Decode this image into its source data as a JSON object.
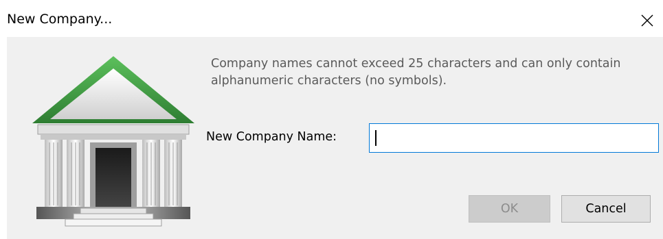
{
  "window": {
    "title": "New Company..."
  },
  "icons": {
    "close": "close-icon",
    "company": "bank-building-icon"
  },
  "dialog": {
    "message": "Company names cannot exceed 25 characters and can only contain alphanumeric characters (no symbols).",
    "name_label": "New Company Name:",
    "name_value": "",
    "ok_label": "OK",
    "cancel_label": "Cancel",
    "ok_enabled": false
  },
  "colors": {
    "background": "#f0f0f0",
    "roof_green": "#3f9a3f",
    "input_focus_border": "#0078d7"
  }
}
